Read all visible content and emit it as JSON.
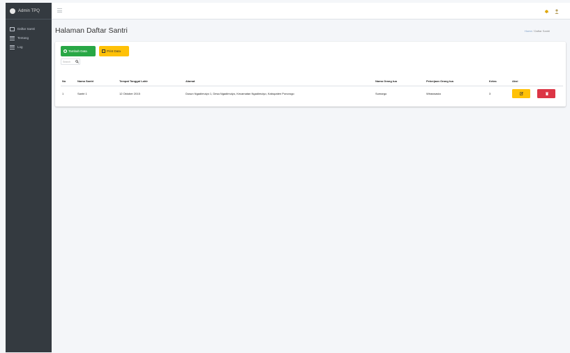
{
  "sidebar": {
    "brand": "Admin TPQ",
    "items": [
      {
        "label": "Daftar Santri",
        "icon": "id-card-icon"
      },
      {
        "label": "Tentang",
        "icon": "list-icon"
      },
      {
        "label": "Log",
        "icon": "list-icon"
      }
    ]
  },
  "topbar": {
    "icons": [
      "hamburger-menu-icon",
      "bell-icon",
      "user-icon"
    ]
  },
  "page": {
    "title": "Halaman Daftar Santri",
    "breadcrumb": {
      "home": "Home",
      "current": "Daftar Santri"
    }
  },
  "toolbar": {
    "add_label": "Tambah Data",
    "print_label": "Print Data",
    "search_placeholder": "Search"
  },
  "table": {
    "headers": [
      "No",
      "Nama Santri",
      "Tempat Tanggal Lahir",
      "Alamat",
      "Nama Orang tua",
      "Pekerjaan Orang tua",
      "Kelas",
      "Aksi"
    ],
    "rows": [
      {
        "no": "1",
        "nama": "Santri 1",
        "ttl": "12 Oktober 2015",
        "alamat": "Dusun Ngadimulyo 1, Desa Ngadimulyo, Kecamatan Ngadimulyo, Kabupaten Ponorogo",
        "ortu": "Sumargo",
        "pekerjaan": "Wiraswasta",
        "kelas": "3"
      }
    ]
  },
  "colors": {
    "sidebar": "#343a40",
    "success": "#28a745",
    "warning": "#ffc107",
    "danger": "#dc3545"
  }
}
